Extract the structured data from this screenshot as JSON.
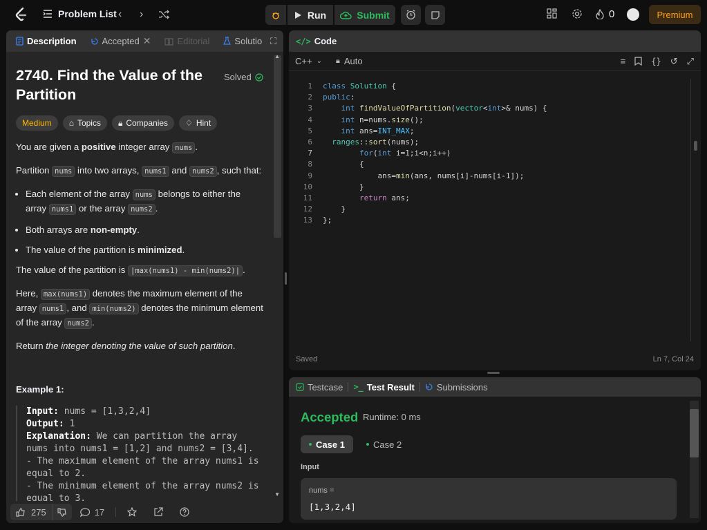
{
  "topbar": {
    "problem_list": "Problem List",
    "run": "Run",
    "submit": "Submit",
    "streak": "0",
    "premium": "Premium"
  },
  "left_tabs": {
    "description": "Description",
    "accepted": "Accepted",
    "editorial": "Editorial",
    "solutions": "Solutio"
  },
  "problem": {
    "title": "2740. Find the Value of the Partition",
    "solved": "Solved",
    "difficulty": "Medium",
    "topics": "Topics",
    "companies": "Companies",
    "hint": "Hint",
    "p1_a": "You are given a ",
    "p1_b": "positive",
    "p1_c": " integer array ",
    "nums": "nums",
    "nums1": "nums1",
    "nums2": "nums2",
    "p2_a": "Partition ",
    "p2_b": " into two arrays, ",
    "p2_c": " and ",
    "p2_d": ", such that:",
    "li1_a": "Each element of the array ",
    "li1_b": " belongs to either the array ",
    "li1_c": " or the array ",
    "li2_a": "Both arrays are ",
    "li2_b": "non-empty",
    "li3_a": "The value of the partition is ",
    "li3_b": "minimized",
    "p3_a": "The value of the partition is ",
    "p3_code": "|max(nums1) - min(nums2)|",
    "p4_a": "Here, ",
    "p4_code1": "max(nums1)",
    "p4_b": " denotes the maximum element of the array ",
    "p4_c": ", and ",
    "p4_code2": "min(nums2)",
    "p4_d": " denotes the minimum element of the array ",
    "p5_a": "Return ",
    "p5_b": "the integer denoting the value of such partition",
    "example_title": "Example 1:",
    "ex_input_lbl": "Input:",
    "ex_input": " nums = [1,3,2,4]",
    "ex_output_lbl": "Output:",
    "ex_output": " 1",
    "ex_expl_lbl": "Explanation:",
    "ex_expl": " We can partition the array nums into nums1 = [1,2] and nums2 = [3,4].\n- The maximum element of the array nums1 is equal to 2.\n- The minimum element of the array nums2 is equal to 3."
  },
  "footer": {
    "likes": "275",
    "comments": "17"
  },
  "code_panel": {
    "title": "Code",
    "language": "C++",
    "mode": "Auto",
    "status_left": "Saved",
    "status_right": "Ln 7, Col 24"
  },
  "code_lines": [
    "class Solution {",
    "public:",
    "    int findValueOfPartition(vector<int>& nums) {",
    "    int n=nums.size();",
    "    int ans=INT_MAX;",
    "  ranges::sort(nums);",
    "        for(int i=1;i<n;i++)",
    "        {",
    "            ans=min(ans, nums[i]-nums[i-1]);",
    "        }",
    "        return ans;",
    "    }",
    "};"
  ],
  "result_panel": {
    "testcase": "Testcase",
    "test_result": "Test Result",
    "submissions": "Submissions",
    "verdict": "Accepted",
    "runtime": "Runtime: 0 ms",
    "case1": "Case 1",
    "case2": "Case 2",
    "input_label": "Input",
    "var_name": "nums =",
    "var_value": "[1,3,2,4]"
  }
}
